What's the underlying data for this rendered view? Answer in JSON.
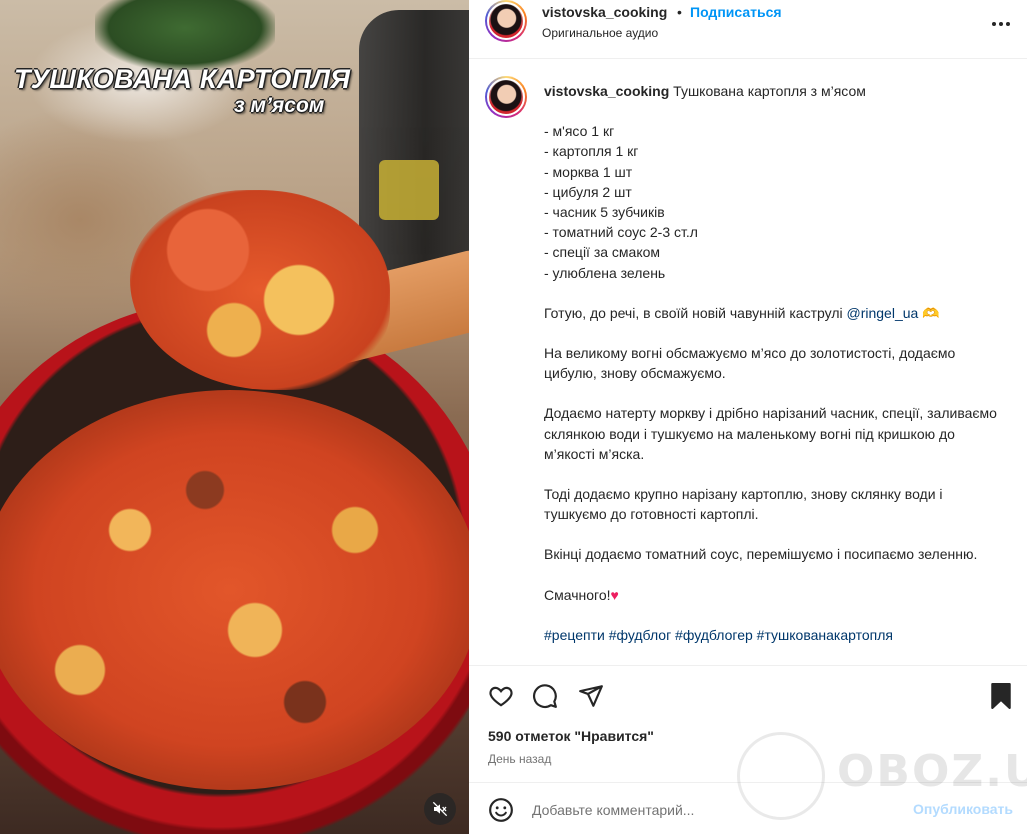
{
  "media": {
    "title_line1": "ТУШКОВАНА КАРТОПЛЯ",
    "title_line2": "з м’ясом"
  },
  "header": {
    "username": "vistovska_cooking",
    "separator": "•",
    "follow_label": "Подписаться",
    "audio_label": "Оригинальное аудио"
  },
  "caption": {
    "username": "vistovska_cooking",
    "title": "Тушкована картопля з м’ясом",
    "ingredients": [
      "- м'ясо 1 кг",
      "- картопля 1 кг",
      "- морква 1 шт",
      "- цибуля 2 шт",
      "- часник 5 зубчиків",
      "- томатний соус 2-3 ст.л",
      "- спеції за смаком",
      "- улюблена зелень"
    ],
    "cookware_text": "Готую, до речі, в своїй новій чавунній каструлі ",
    "cookware_mention": "@ringel_ua",
    "cookware_emoji": "🫶",
    "step1": "На великому вогні обсмажуємо м’ясо до золотистості, додаємо цибулю, знову обсмажуємо.",
    "step2": "Додаємо натерту моркву і дрібно нарізаний часник, спеції, заливаємо склянкою води і тушкуємо на маленькому вогні під кришкою до м’якості м’яска.",
    "step3": "Тоді додаємо крупно нарізану картоплю, знову склянку води і тушкуємо до готовності картоплі.",
    "step4": "Вкінці додаємо томатний соус, перемішуємо і посипаємо зеленню.",
    "closing": "Смачного!",
    "closing_emoji": "♥",
    "hashtags": "#рецепти #фудблог #фудблогер #тушкованакартопля"
  },
  "actions": {
    "likes_text": "590 отметок \"Нравится\"",
    "time_text": "День назад"
  },
  "comment": {
    "placeholder": "Добавьте комментарий...",
    "post_label": "Опубликовать"
  },
  "watermark": {
    "text": "OBOZ.UA"
  },
  "colors": {
    "accent": "#0095f6",
    "link": "#00376b",
    "heart": "#ed1e60",
    "post_disabled": "#b3dbff"
  }
}
